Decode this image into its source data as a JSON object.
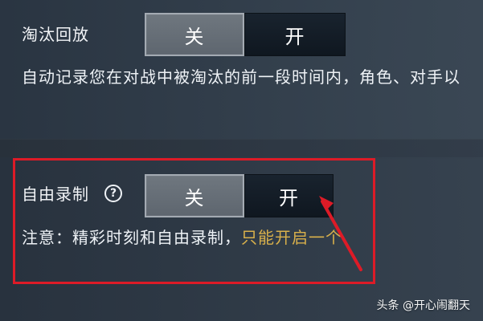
{
  "settings": {
    "eliminationReplay": {
      "label": "淘汰回放",
      "offLabel": "关",
      "onLabel": "开",
      "description": "自动记录您在对战中被淘汰的前一段时间内，角色、对手以"
    },
    "freeRecording": {
      "label": "自由录制",
      "helpIcon": "question-circle-icon",
      "helpSymbol": "?",
      "offLabel": "关",
      "onLabel": "开",
      "notePrefix": "注意：精彩时刻和自由录制，",
      "noteHighlight": "只能开启一个"
    }
  },
  "watermark": {
    "text": "头条 @开心闹翻天"
  },
  "colors": {
    "highlight": "#dd1b27",
    "accentText": "#d8b04b"
  }
}
